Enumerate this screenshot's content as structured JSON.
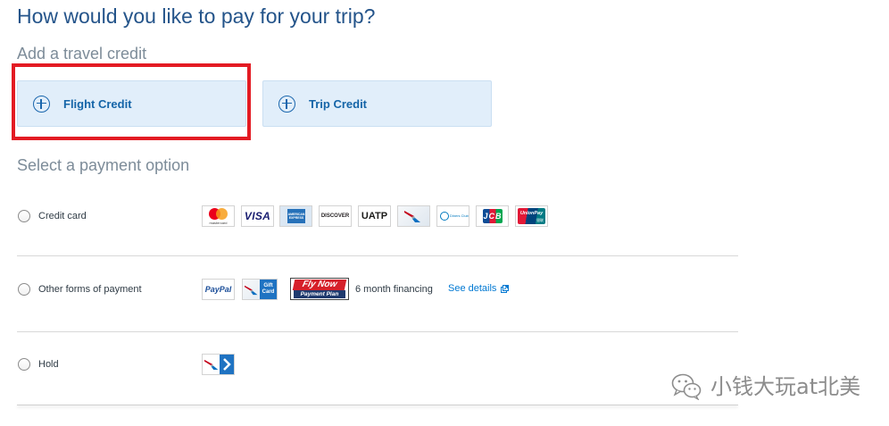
{
  "page": {
    "title": "How would you like to pay for your trip?"
  },
  "travel_credit": {
    "heading": "Add a travel credit",
    "flight_credit": {
      "label": "Flight Credit",
      "icon": "plus-circle-icon"
    },
    "trip_credit": {
      "label": "Trip Credit",
      "icon": "plus-circle-icon"
    }
  },
  "payment": {
    "heading": "Select a payment option",
    "options": [
      {
        "label": "Credit card",
        "selected": false,
        "logo_text": {
          "mastercard": "mastercard",
          "visa": "VISA",
          "amex": "AMERICAN EXPRESS",
          "discover": "DISCOVER",
          "uatp": "UATP",
          "diners": "Diners Club",
          "jcb": "JCB",
          "unionpay": "UnionPay",
          "unionpay_cn": "银联"
        },
        "logo_icons": [
          "mastercard-logo",
          "visa-logo",
          "amex-logo",
          "discover-logo",
          "uatp-logo",
          "aa-card-logo",
          "diners-club-logo",
          "jcb-logo",
          "unionpay-logo"
        ]
      },
      {
        "label": "Other forms of payment",
        "selected": false,
        "logo_text": {
          "paypal": "PayPal",
          "gift_card": "Gift Card",
          "fly_now": "Fly Now",
          "payment_plan": "Payment Plan"
        },
        "logo_icons": [
          "paypal-logo",
          "aa-gift-card-logo",
          "fly-now-payment-plan-logo"
        ],
        "financing_text": "6 month financing",
        "details_link": {
          "label": "See details",
          "icon": "external-link-icon"
        }
      },
      {
        "label": "Hold",
        "selected": false,
        "logo_icons": [
          "aa-hold-logo"
        ]
      }
    ]
  },
  "watermark": {
    "icon": "wechat-icon",
    "text": "小钱大玩at北美"
  },
  "colors": {
    "title": "#24548a",
    "muted_text": "#7d8c99",
    "button_bg": "#e1eefa",
    "button_text": "#1565a8",
    "link": "#0078d2",
    "highlight": "#e31b23",
    "divider": "#d8d8d8"
  }
}
